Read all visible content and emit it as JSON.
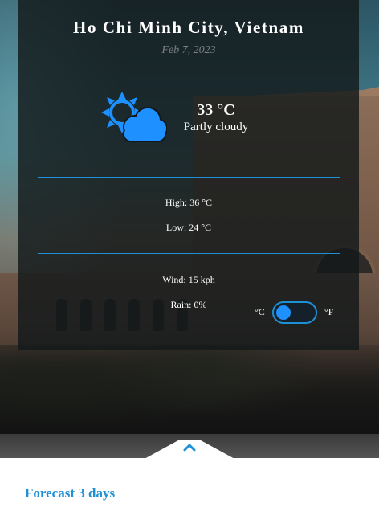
{
  "location": {
    "city": "Ho Chi Minh City, Vietnam",
    "date": "Feb 7, 2023"
  },
  "current": {
    "temperature": "33 °C",
    "condition": "Partly cloudy",
    "icon": "partly-cloudy-icon"
  },
  "details": {
    "high": "High: 36 °C",
    "low": "Low: 24 °C",
    "wind": "Wind: 15 kph",
    "rain": "Rain: 0%"
  },
  "units": {
    "celsius_label": "°C",
    "fahrenheit_label": "°F",
    "selected": "°C"
  },
  "panel": {
    "forecast_title": "Forecast 3 days",
    "toggle_icon": "chevron-up-icon"
  },
  "colors": {
    "accent": "#1e90d6",
    "icon_blue": "#1e90ff",
    "date_gray": "#7c8186"
  }
}
